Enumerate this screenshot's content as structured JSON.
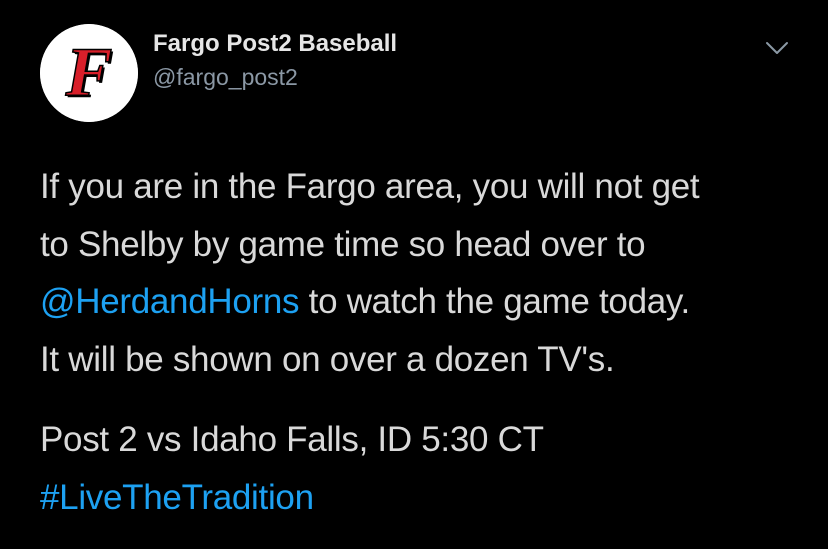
{
  "author": {
    "display_name": "Fargo Post2 Baseball",
    "handle": "@fargo_post2",
    "avatar_letter": "F",
    "avatar_icon": "fargo-f-logo-icon"
  },
  "menu": {
    "icon": "chevron-down-icon"
  },
  "tweet": {
    "line1": "If you are in the Fargo area, you will not get",
    "line2": "to Shelby by game time so head over to",
    "mention": "@HerdandHorns",
    "line3_rest": " to watch the game today.",
    "line4": "It will be shown on over a dozen TV's.",
    "line5": "Post 2 vs Idaho Falls, ID 5:30 CT",
    "hashtag": "#LiveTheTradition"
  },
  "colors": {
    "background": "#000000",
    "text": "#d9d9d9",
    "link": "#1da1f2",
    "handle": "#8b98a5",
    "logo_red": "#d81f2a"
  }
}
